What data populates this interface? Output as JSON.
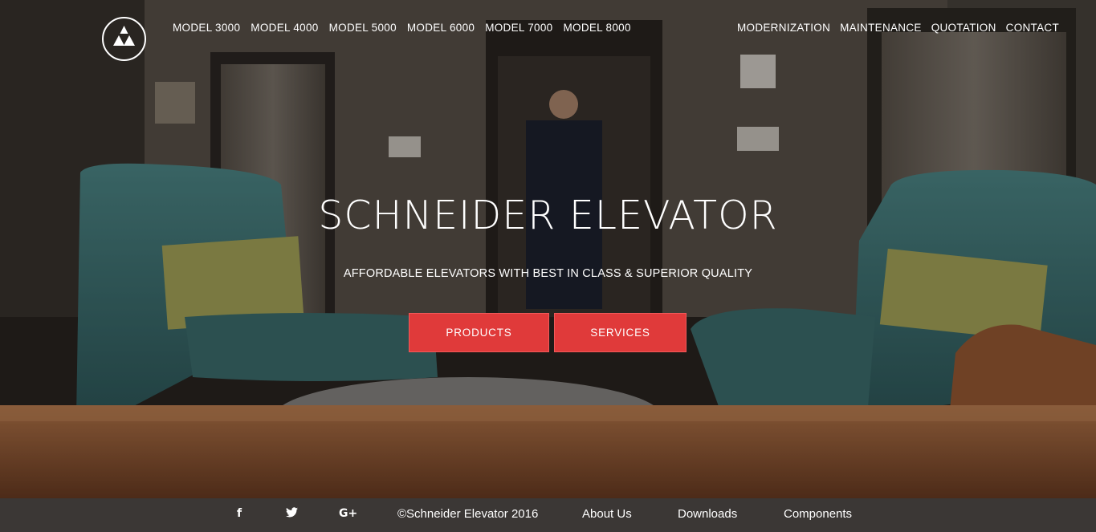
{
  "brand": {
    "logo": "schneider-triangle-logo"
  },
  "nav": {
    "left": [
      "MODEL 3000",
      "MODEL 4000",
      "MODEL 5000",
      "MODEL 6000",
      "MODEL 7000",
      "MODEL 8000"
    ],
    "right": [
      "MODERNIZATION",
      "MAINTENANCE",
      "QUOTATION",
      "CONTACT"
    ]
  },
  "hero": {
    "title": "SCHNEIDER ELEVATOR",
    "tagline": "AFFORDABLE ELEVATORS WITH BEST IN CLASS & SUPERIOR QUALITY",
    "buttons": {
      "products": "PRODUCTS",
      "services": "SERVICES"
    },
    "button_color": "#e03a3a"
  },
  "footer": {
    "social": {
      "facebook": "f",
      "twitter": "t",
      "google_plus": "G+"
    },
    "copyright": "©Schneider Elevator 2016",
    "links": [
      "About Us",
      "Downloads",
      "Components"
    ]
  }
}
